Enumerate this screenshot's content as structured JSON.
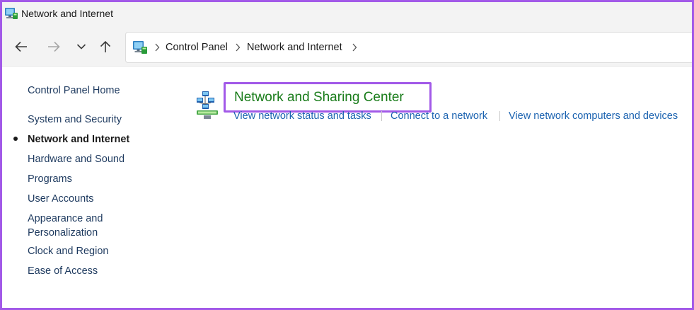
{
  "window": {
    "title": "Network and Internet"
  },
  "nav": {
    "back_icon": "arrow-left-icon",
    "forward_icon": "arrow-right-icon",
    "recent_icon": "chevron-down-icon",
    "up_icon": "arrow-up-icon"
  },
  "address_bar": {
    "icon": "control-panel-icon",
    "breadcrumbs": [
      "Control Panel",
      "Network and Internet"
    ]
  },
  "sidebar": {
    "home": "Control Panel Home",
    "items": [
      {
        "label": "System and Security",
        "active": false
      },
      {
        "label": "Network and Internet",
        "active": true
      },
      {
        "label": "Hardware and Sound",
        "active": false
      },
      {
        "label": "Programs",
        "active": false
      },
      {
        "label": "User Accounts",
        "active": false
      },
      {
        "label": "Appearance and Personalization",
        "active": false
      },
      {
        "label": "Clock and Region",
        "active": false
      },
      {
        "label": "Ease of Access",
        "active": false
      }
    ]
  },
  "main": {
    "category": {
      "icon": "network-sharing-icon",
      "title": "Network and Sharing Center",
      "tasks": [
        "View network status and tasks",
        "Connect to a network",
        "View network computers and devices"
      ]
    }
  },
  "colors": {
    "highlight": "#a259e8",
    "category_title": "#197c1a",
    "link": "#1a62b0"
  }
}
